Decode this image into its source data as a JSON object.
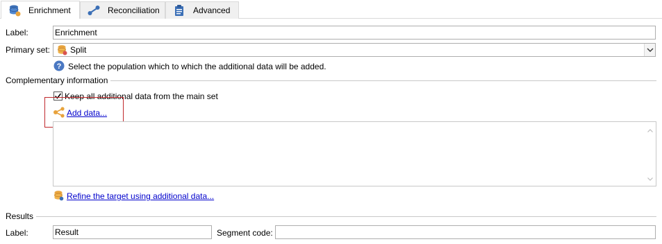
{
  "tabs": [
    {
      "label": "Enrichment",
      "icon": "enrichment-db-icon",
      "active": true
    },
    {
      "label": "Reconciliation",
      "icon": "link-nodes-icon",
      "active": false
    },
    {
      "label": "Advanced",
      "icon": "clipboard-icon",
      "active": false
    }
  ],
  "form": {
    "label_caption": "Label:",
    "label_value": "Enrichment",
    "primary_set_caption": "Primary set:",
    "primary_set_value": "Split",
    "help_text": "Select the population which to which the additional data will be added."
  },
  "complementary": {
    "title": "Complementary information",
    "keep_all_label": "Keep all additional data from the main set",
    "keep_all_checked": true,
    "add_data_link": "Add data...",
    "refine_link": "Refine the target using additional data..."
  },
  "results": {
    "title": "Results",
    "label_caption": "Label:",
    "label_value": "Result",
    "segment_caption": "Segment code:",
    "segment_value": ""
  },
  "colors": {
    "accent_orange": "#e8a33d",
    "link_blue": "#0000cc",
    "highlight_red": "#c0282c",
    "help_blue": "#4a78c2"
  }
}
